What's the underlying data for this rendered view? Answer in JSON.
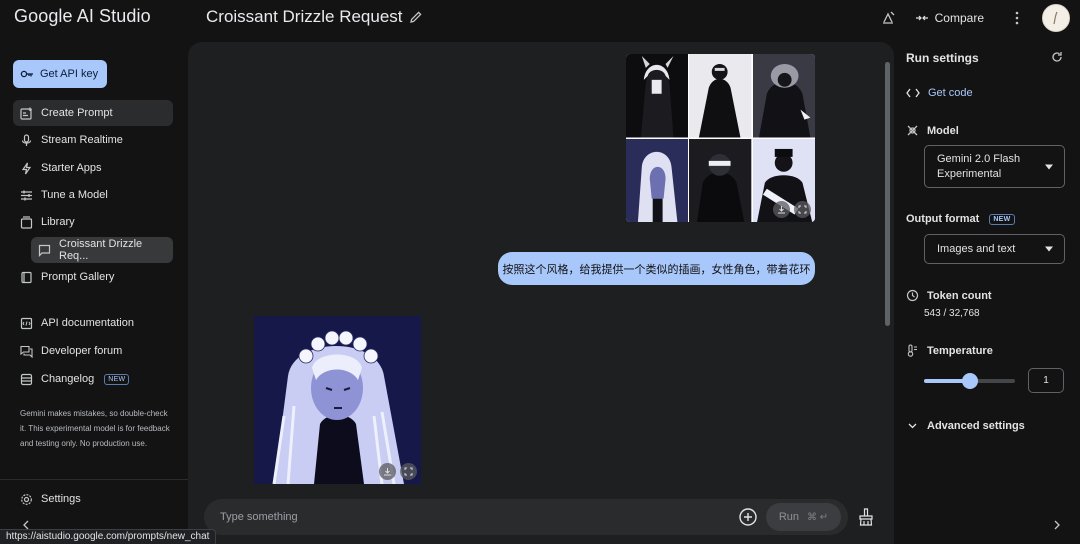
{
  "header": {
    "app_title": "Google AI Studio",
    "prompt_title": "Croissant Drizzle Request",
    "compare_label": "Compare"
  },
  "sidebar": {
    "api_key_label": "Get API key",
    "items": [
      {
        "label": "Create Prompt",
        "icon": "create-prompt-icon",
        "active": true
      },
      {
        "label": "Stream Realtime",
        "icon": "mic-icon"
      },
      {
        "label": "Starter Apps",
        "icon": "lightning-icon"
      },
      {
        "label": "Tune a Model",
        "icon": "tune-icon"
      },
      {
        "label": "Library",
        "icon": "library-icon"
      },
      {
        "label": "Croissant Drizzle Req...",
        "icon": "chat-icon",
        "sub": true
      },
      {
        "label": "Prompt Gallery",
        "icon": "gallery-icon"
      },
      {
        "label": "API documentation",
        "icon": "docs-icon"
      },
      {
        "label": "Developer forum",
        "icon": "forum-icon"
      },
      {
        "label": "Changelog",
        "icon": "changelog-icon",
        "badge": "NEW"
      }
    ],
    "disclaimer": "Gemini makes mistakes, so double-check it. This experimental model is for feedback and testing only. No production use.",
    "settings_label": "Settings"
  },
  "chat": {
    "user_message": "按照这个风格，给我提供一个类似的插画，女性角色，带着花环",
    "input_placeholder": "Type something",
    "run_label": "Run",
    "run_shortcut": "⌘ ↵"
  },
  "run_settings": {
    "title": "Run settings",
    "get_code_label": "Get code",
    "model_label": "Model",
    "model_value": "Gemini 2.0 Flash Experimental",
    "output_format_label": "Output format",
    "output_format_badge": "NEW",
    "output_format_value": "Images and text",
    "token_count_label": "Token count",
    "token_count_value": "543 / 32,768",
    "temperature_label": "Temperature",
    "temperature_value": "1",
    "temperature_fraction": 0.5,
    "advanced_label": "Advanced settings"
  },
  "status_url": "https://aistudio.google.com/prompts/new_chat",
  "colors": {
    "accent": "#a8c7fa",
    "background": "#131314",
    "surface": "#1e1f20"
  }
}
